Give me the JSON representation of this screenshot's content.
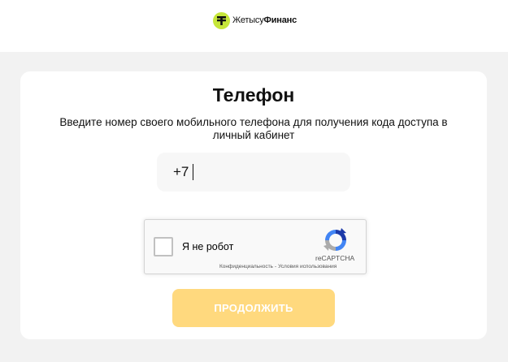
{
  "header": {
    "logo_text_part1": "Жетысу",
    "logo_text_part2": "Финанс",
    "logo_icon": "jetysu-logo-icon",
    "logo_color": "#c6e63a"
  },
  "card": {
    "title": "Телефон",
    "subtitle": "Введите номер своего мобильного телефона для получения кода доступа в личный кабинет",
    "phone_value": "+7"
  },
  "recaptcha": {
    "label": "Я не робот",
    "brand": "reCAPTCHA",
    "privacy_link": "Конфиденциальность",
    "separator": "-",
    "terms_link": "Условия использования",
    "icon": "recaptcha-logo-icon"
  },
  "actions": {
    "continue_label": "ПРОДОЛЖИТЬ",
    "continue_color": "#ffd97e"
  }
}
